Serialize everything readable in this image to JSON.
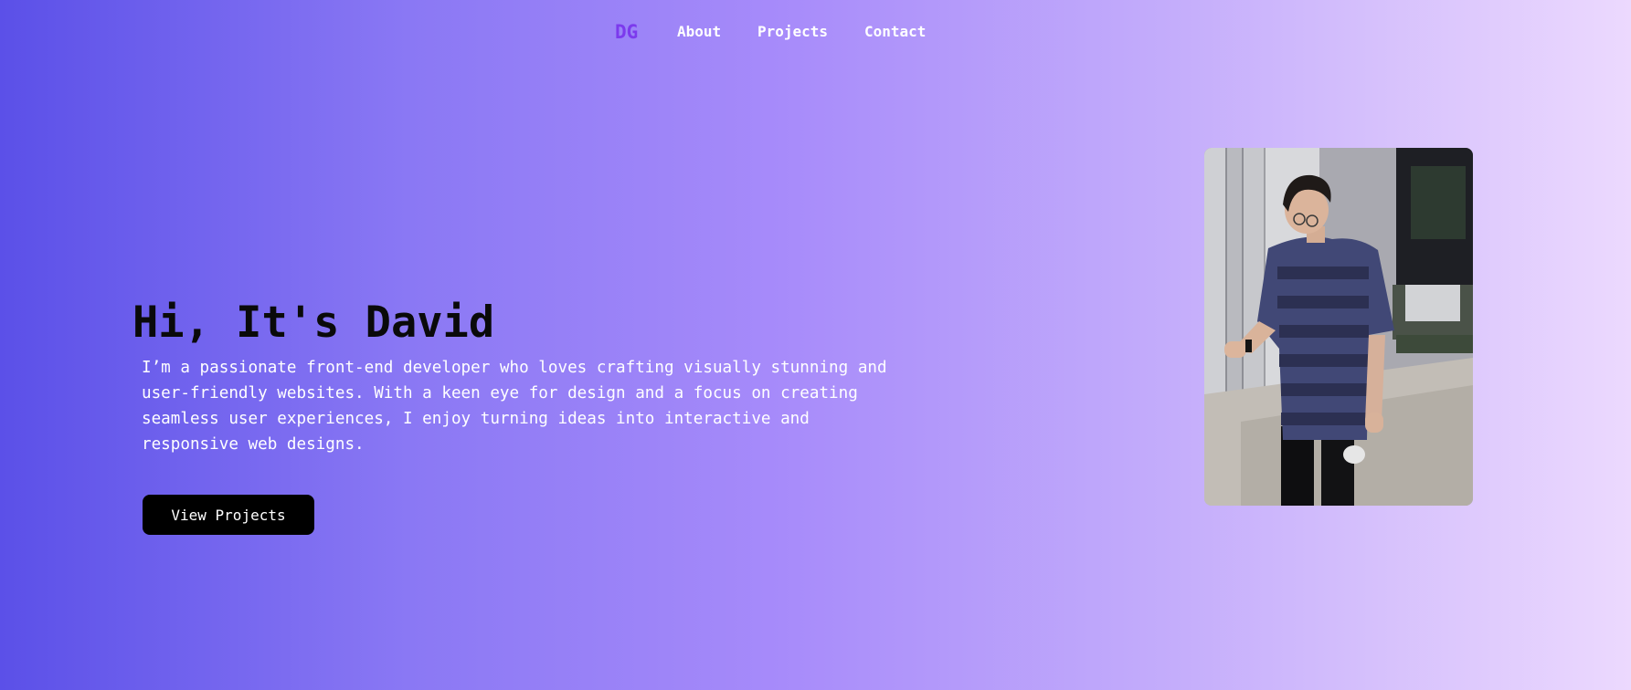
{
  "nav": {
    "logo": "DG",
    "links": [
      {
        "label": "About"
      },
      {
        "label": "Projects"
      },
      {
        "label": "Contact"
      }
    ]
  },
  "hero": {
    "title": "Hi, It's David",
    "description": "I’m a passionate front-end developer who loves crafting visually stunning and user-friendly websites. With a keen eye for design and a focus on creating seamless user experiences, I enjoy turning ideas into interactive and responsive web designs.",
    "cta_label": "View Projects"
  },
  "colors": {
    "gradient_start": "#5b50e8",
    "gradient_end": "#ecd9fe",
    "logo": "#7c3aed",
    "button": "#000000"
  }
}
